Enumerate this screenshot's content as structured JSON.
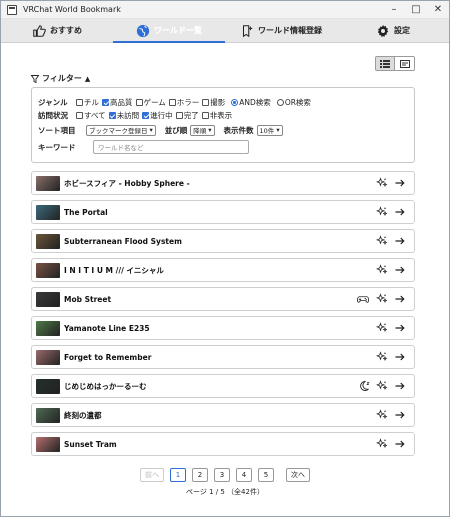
{
  "window": {
    "title": "VRChat World Bookmark"
  },
  "tabs": [
    {
      "label": "おすすめ",
      "icon": "thumbs-up-icon"
    },
    {
      "label": "ワールド一覧",
      "icon": "globe-icon",
      "active": true
    },
    {
      "label": "ワールド情報登録",
      "icon": "bookmark-plus-icon"
    },
    {
      "label": "設定",
      "icon": "gear-icon"
    }
  ],
  "filter": {
    "toggle_label": "フィルター",
    "genre_label": "ジャンル",
    "genres": [
      {
        "label": "チル",
        "checked": false
      },
      {
        "label": "高品質",
        "checked": true
      },
      {
        "label": "ゲーム",
        "checked": false
      },
      {
        "label": "ホラー",
        "checked": false
      },
      {
        "label": "撮影",
        "checked": false
      }
    ],
    "mode_and": "AND検索",
    "mode_or": "OR検索",
    "visit_label": "訪問状況",
    "visits": [
      {
        "label": "すべて",
        "checked": false
      },
      {
        "label": "未訪問",
        "checked": true
      },
      {
        "label": "進行中",
        "checked": true
      },
      {
        "label": "完了",
        "checked": false
      },
      {
        "label": "非表示",
        "checked": false
      }
    ],
    "sort_label": "ソート項目",
    "sort_value": "ブックマーク登録日",
    "order_label": "並び順",
    "order_value": "降順",
    "count_label": "表示件数",
    "count_value": "10件",
    "keyword_label": "キーワード",
    "keyword_placeholder": "ワールド名など"
  },
  "worlds": [
    {
      "name": "ホビースフィア - Hobby Sphere -",
      "thumb": "#8a6f6a",
      "extra": ""
    },
    {
      "name": "The Portal",
      "thumb": "#3c6b7c",
      "extra": ""
    },
    {
      "name": "Subterranean Flood System",
      "thumb": "#6b5638",
      "extra": ""
    },
    {
      "name": "I N I T I U M /// イニシャル",
      "thumb": "#7a5244",
      "extra": ""
    },
    {
      "name": "Mob Street",
      "thumb": "#3a3a3a",
      "extra": "gamepad-icon"
    },
    {
      "name": "Yamanote Line E235",
      "thumb": "#4f7a46",
      "extra": ""
    },
    {
      "name": "Forget to Remember",
      "thumb": "#9a6a6a",
      "extra": ""
    },
    {
      "name": "じめじめはっかーるーむ",
      "thumb": "#25302b",
      "extra": "moon-icon"
    },
    {
      "name": "終刻の遺都",
      "thumb": "#4f6b55",
      "extra": ""
    },
    {
      "name": "Sunset Tram",
      "thumb": "#b56f6f",
      "extra": ""
    }
  ],
  "pager": {
    "prev": "前へ",
    "pages": [
      "1",
      "2",
      "3",
      "4",
      "5"
    ],
    "current": "1",
    "next": "次へ",
    "info": "ページ 1 / 5 （全42件）"
  },
  "colors": {
    "accent": "#2f6fd6"
  }
}
